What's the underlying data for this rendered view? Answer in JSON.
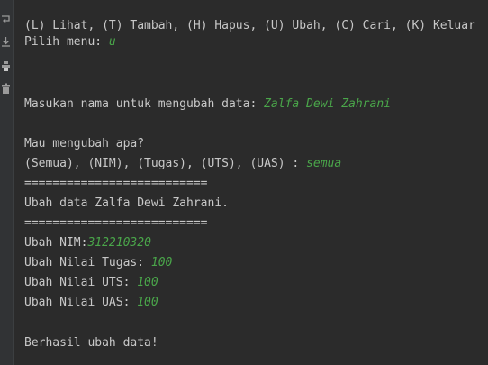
{
  "console": {
    "menu_line": "(L) Lihat, (T) Tambah, (H) Hapus, (U) Ubah, (C) Cari, (K) Keluar",
    "prompt_menu": "Pilih menu: ",
    "input_menu": "u",
    "prompt_name": "Masukan nama untuk mengubah data: ",
    "input_name": "Zalfa Dewi Zahrani",
    "question": "Mau mengubah apa?",
    "options": "(Semua), (NIM), (Tugas), (UTS), (UAS) : ",
    "input_option": "semua",
    "separator_top": "==========================",
    "title": "Ubah data Zalfa Dewi Zahrani.",
    "separator_bottom": "==========================",
    "prompt_nim": "Ubah NIM:",
    "input_nim": "312210320",
    "prompt_tugas": "Ubah Nilai Tugas: ",
    "input_tugas": "100",
    "prompt_uts": "Ubah Nilai UTS: ",
    "input_uts": "100",
    "prompt_uas": "Ubah Nilai UAS: ",
    "input_uas": "100",
    "success": "Berhasil ubah data!"
  },
  "gutter": {
    "icons": [
      "soft-wrap-icon",
      "scroll-to-end-icon",
      "print-icon",
      "trash-icon"
    ]
  },
  "colors": {
    "background": "#2b2b2b",
    "text": "#c8c8c8",
    "user_input": "#4aa64a"
  }
}
